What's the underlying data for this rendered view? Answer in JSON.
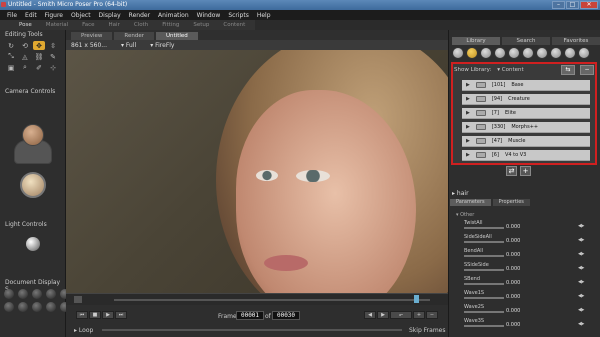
{
  "window": {
    "title": "Untitled - Smith Micro Poser Pro  (64-bit)",
    "controls": [
      "–",
      "□",
      "✕"
    ]
  },
  "menu": [
    "File",
    "Edit",
    "Figure",
    "Object",
    "Display",
    "Render",
    "Animation",
    "Window",
    "Scripts",
    "Help"
  ],
  "rooms": [
    "Pose",
    "Material",
    "Face",
    "Hair",
    "Cloth",
    "Fitting",
    "Setup",
    "Content"
  ],
  "left": {
    "editing_tools": "Editing Tools",
    "camera_controls": "Camera Controls",
    "light_controls": "Light Controls",
    "document_display": "Document Display S"
  },
  "viewport": {
    "tabs": [
      "Preview",
      "Render",
      "Untitled"
    ],
    "size": "861 x 560...",
    "mode": "Full",
    "renderer": "FireFly"
  },
  "transport": {
    "frame_label": "Frame:",
    "frame_current": "00001",
    "of_label": "of",
    "frame_total": "00030",
    "loop": "Loop",
    "skip_frames": "Skip Frames"
  },
  "library": {
    "tabs": [
      "Library",
      "Search",
      "Favorites"
    ],
    "show_library": "Show Library:",
    "content": "Content",
    "items": [
      {
        "count": "[101]",
        "name": "Base"
      },
      {
        "count": "[94]",
        "name": "Creature"
      },
      {
        "count": "[7]",
        "name": "Elite"
      },
      {
        "count": "[330]",
        "name": "Morphs++"
      },
      {
        "count": "[47]",
        "name": "Muscle"
      },
      {
        "count": "[6]",
        "name": "V4 to V3"
      }
    ]
  },
  "params": {
    "object": "hair",
    "tabs": [
      "Parameters",
      "Properties"
    ],
    "group": "Other",
    "items": [
      {
        "name": "TwistAll",
        "value": "0.000"
      },
      {
        "name": "SideSideAll",
        "value": "0.000"
      },
      {
        "name": "BendAll",
        "value": "0.000"
      },
      {
        "name": "SSideSide",
        "value": "0.000"
      },
      {
        "name": "SBend",
        "value": "0.000"
      },
      {
        "name": "Wave1S",
        "value": "0.000"
      },
      {
        "name": "Wave2S",
        "value": "0.000"
      },
      {
        "name": "Wave3S",
        "value": "0.000"
      }
    ]
  }
}
